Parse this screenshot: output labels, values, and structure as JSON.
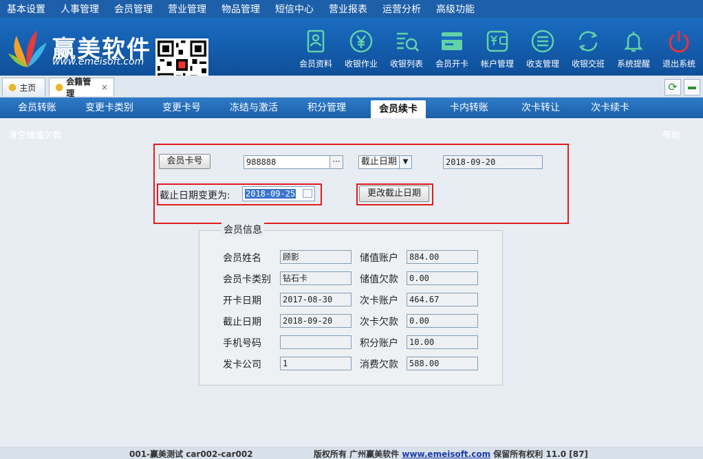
{
  "menu": [
    "基本设置",
    "人事管理",
    "会员管理",
    "营业管理",
    "物品管理",
    "短信中心",
    "营业报表",
    "运营分析",
    "高级功能"
  ],
  "brand": {
    "name": "赢美软件",
    "url": "www.emeisoft.com"
  },
  "header_buttons": [
    {
      "label": "会员资料",
      "icon": "member-card-icon"
    },
    {
      "label": "收银作业",
      "icon": "yen-circle-icon"
    },
    {
      "label": "收银列表",
      "icon": "list-search-icon"
    },
    {
      "label": "会员开卡",
      "icon": "card-icon"
    },
    {
      "label": "帐户管理",
      "icon": "wallet-icon"
    },
    {
      "label": "收支管理",
      "icon": "lines-circle-icon"
    },
    {
      "label": "收银交班",
      "icon": "cycle-icon"
    },
    {
      "label": "系统提醒",
      "icon": "bell-icon"
    },
    {
      "label": "退出系统",
      "icon": "power-icon"
    }
  ],
  "tabs": [
    {
      "label": "主页",
      "closable": false
    },
    {
      "label": "会籍管理",
      "closable": true,
      "close": "×"
    }
  ],
  "refresh_glyph": "⟳",
  "subnav": [
    "会员转账",
    "变更卡类别",
    "变更卡号",
    "冻结与激活",
    "积分管理",
    "会员续卡",
    "卡内转账",
    "次卡转让",
    "次卡续卡"
  ],
  "subnav_active": "会员续卡",
  "toolbar": {
    "left_link": "清空储值欠款",
    "help": "帮助"
  },
  "renew_form": {
    "card_button": "会员卡号",
    "card_number": "988888",
    "ellipsis": "···",
    "date_select": "截止日期",
    "current_date": "2018-09-20",
    "change_label": "截止日期变更为:",
    "new_date": "2018-09-25",
    "submit": "更改截止日期"
  },
  "member_info": {
    "legend": "会员信息",
    "left": [
      {
        "label": "会员姓名",
        "value": "顾影"
      },
      {
        "label": "会员卡类别",
        "value": "钻石卡"
      },
      {
        "label": "开卡日期",
        "value": "2017-08-30"
      },
      {
        "label": "截止日期",
        "value": "2018-09-20"
      },
      {
        "label": "手机号码",
        "value": ""
      },
      {
        "label": "发卡公司",
        "value": "1"
      }
    ],
    "right": [
      {
        "label": "储值账户",
        "value": "884.00"
      },
      {
        "label": "储值欠款",
        "value": "0.00"
      },
      {
        "label": "次卡账户",
        "value": "464.67"
      },
      {
        "label": "次卡欠款",
        "value": "0.00"
      },
      {
        "label": "积分账户",
        "value": "10.00"
      },
      {
        "label": "消费欠款",
        "value": "588.00"
      }
    ]
  },
  "footer": {
    "store": "001-赢美测试 car002-car002",
    "copyright_prefix": "版权所有 广州赢美软件",
    "url": "www.emeisoft.com",
    "copyright_suffix": "保留所有权利 11.0 [87]"
  },
  "colors": {
    "menu_bg": "#1d5fa8",
    "header_bg": "#1a6cc2",
    "highlight": "#e21b1b",
    "exit_icon": "#e8343a",
    "icon_green": "#62d3a6"
  }
}
